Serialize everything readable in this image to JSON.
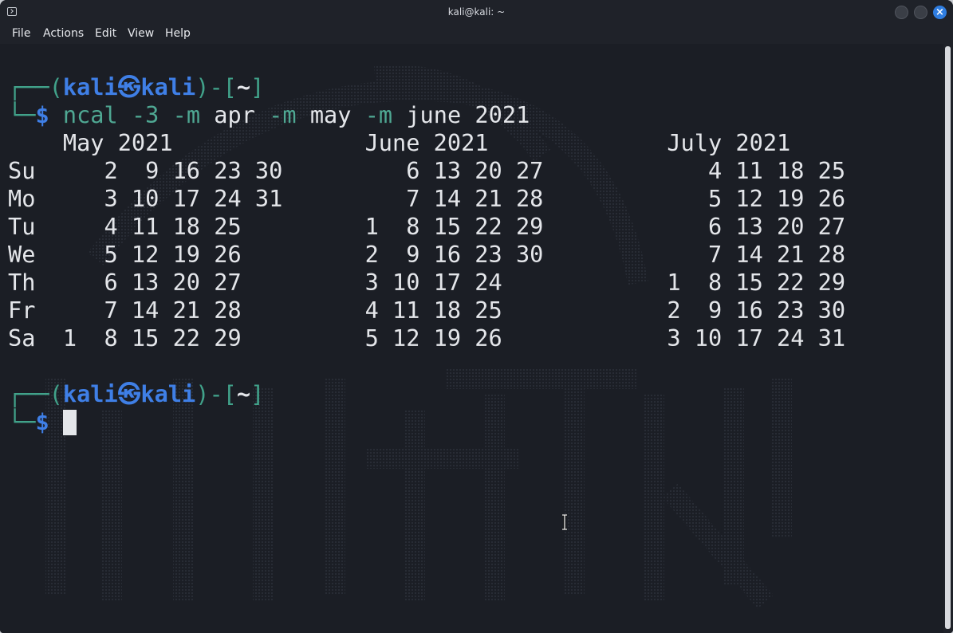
{
  "window": {
    "title": "kali@kali: ~"
  },
  "menubar": {
    "items": [
      "File",
      "Actions",
      "Edit",
      "View",
      "Help"
    ]
  },
  "terminal": {
    "prompt1": {
      "corner_top": "┌──(",
      "user": "kali",
      "skull": "㉿",
      "host": "kali",
      "mid": ")-[",
      "dir": "~",
      "close": "]",
      "corner_bottom": "└─",
      "dollar": "$",
      "cmd_name": "ncal",
      "cmd_arg1": "-3",
      "cmd_arg2": "-m",
      "cmd_val2": "apr",
      "cmd_arg3": "-m",
      "cmd_val3": "may",
      "cmd_arg4": "-m",
      "cmd_val4": "june 2021"
    },
    "output_lines": [
      "    May 2021              June 2021             July 2021",
      "Su     2  9 16 23 30         6 13 20 27            4 11 18 25",
      "Mo     3 10 17 24 31         7 14 21 28            5 12 19 26",
      "Tu     4 11 18 25         1  8 15 22 29            6 13 20 27",
      "We     5 12 19 26         2  9 16 23 30            7 14 21 28",
      "Th     6 13 20 27         3 10 17 24            1  8 15 22 29",
      "Fr     7 14 21 28         4 11 18 25            2  9 16 23 30",
      "Sa  1  8 15 22 29         5 12 19 26            3 10 17 24 31"
    ],
    "prompt2": {
      "corner_top": "┌──(",
      "user": "kali",
      "skull": "㉿",
      "host": "kali",
      "mid": ")-[",
      "dir": "~",
      "close": "]",
      "corner_bottom": "└─",
      "dollar": "$"
    }
  },
  "colors": {
    "prompt_frame": "#41a28a",
    "prompt_user": "#3f7fe6",
    "text": "#e4e6ea",
    "background": "#1b1e25",
    "close_button": "#2f7de0"
  }
}
